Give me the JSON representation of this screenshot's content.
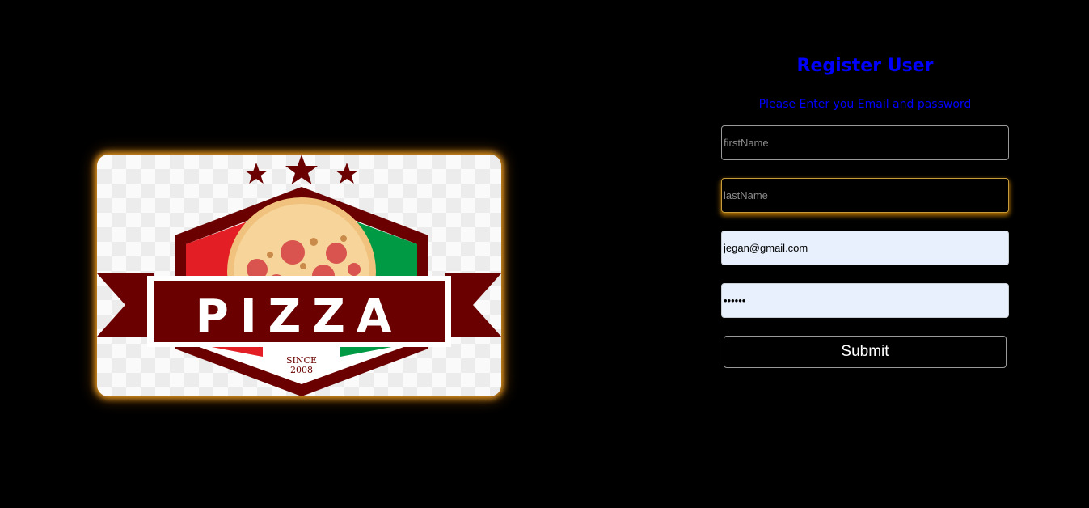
{
  "logo": {
    "brand_text": "PIZZA",
    "since_label": "SINCE",
    "since_year": "2008",
    "icon": "pizza-logo",
    "colors": {
      "maroon": "#6b0000",
      "red": "#e31e24",
      "green": "#009a44",
      "crust": "#f1c27d",
      "glow": "#ffa500"
    }
  },
  "form": {
    "title": "Register User",
    "subtitle": "Please Enter you Email and password",
    "first_name": {
      "placeholder": "firstName",
      "value": ""
    },
    "last_name": {
      "placeholder": "lastName",
      "value": ""
    },
    "email": {
      "placeholder": "",
      "value": "jegan@gmail.com"
    },
    "password": {
      "placeholder": "",
      "value": "••••••"
    },
    "submit_label": "Submit",
    "accent_color": "#0000ff"
  }
}
